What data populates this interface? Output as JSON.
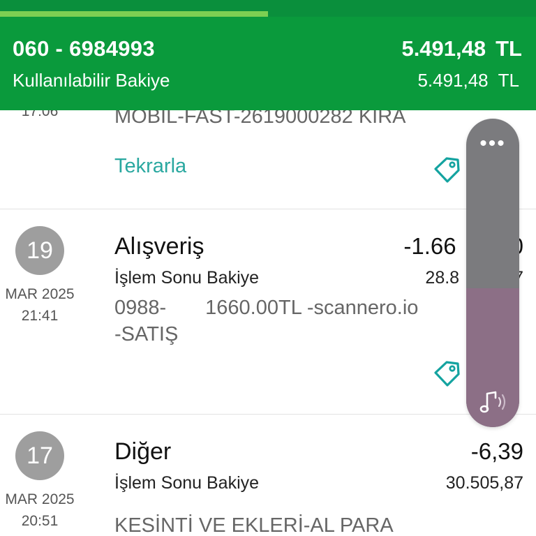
{
  "progress": {
    "fraction": 0.5
  },
  "account": {
    "number": "060 - 6984993",
    "label": "Kullanılabilir Bakiye",
    "balance_amount": "5.491,48",
    "balance_currency": "TL",
    "available_amount": "5.491,48",
    "available_currency": "TL"
  },
  "transactions": [
    {
      "time": "17:06",
      "description": "MOBIL-FAST-2619000282 KIRA",
      "repeat_label": "Tekrarla",
      "icon": "tag-icon"
    },
    {
      "day": "19",
      "month_year": "MAR 2025",
      "time": "21:41",
      "title": "Alışveriş",
      "amount": "-1.66",
      "amount_tail": "0",
      "balance_label": "İşlem Sonu Bakiye",
      "balance_value": "28.8",
      "balance_tail": "7",
      "desc_line1_a": "0988-",
      "desc_line1_b": "1660.00TL -scannero.io",
      "desc_line2": "-SATIŞ",
      "icon": "tag-icon"
    },
    {
      "day": "17",
      "month_year": "MAR 2025",
      "time": "20:51",
      "title": "Diğer",
      "amount": "-6,39",
      "balance_label": "İşlem Sonu Bakiye",
      "balance_value": "30.505,87",
      "description": "KESİNTİ VE EKLERİ-AL PARA"
    }
  ],
  "volume_overlay": {
    "more_label": "•••",
    "level": 0.45,
    "icon": "music-note-icon",
    "track_color": "#7b7b7e",
    "fill_color": "#8c6f86"
  },
  "colors": {
    "header_green": "#0a9a3c",
    "progress_fill": "#7ccf52",
    "link_teal": "#2aa8a0"
  }
}
